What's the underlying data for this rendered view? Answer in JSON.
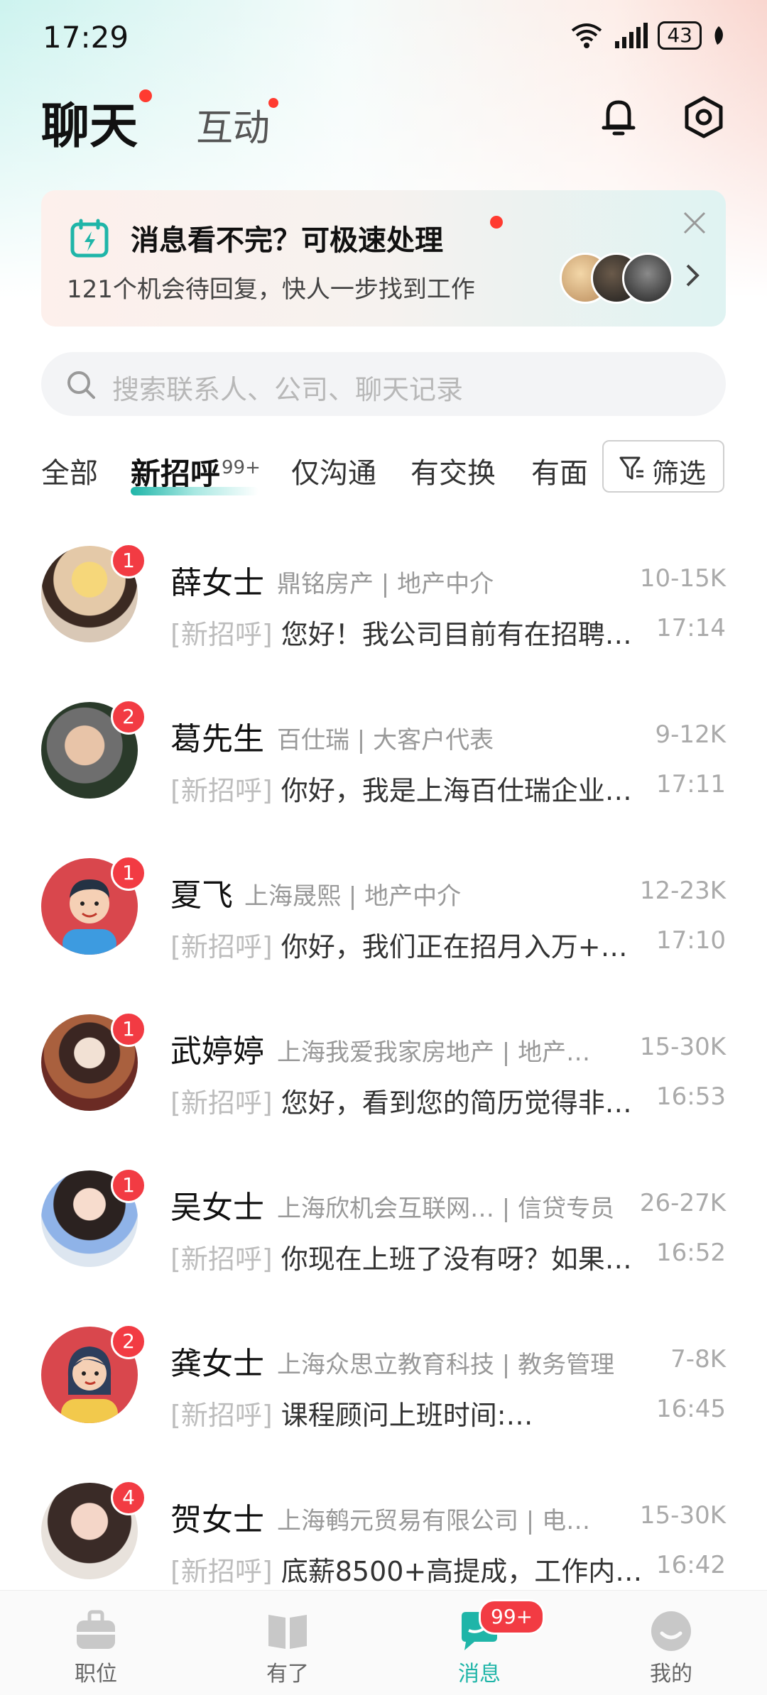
{
  "status_bar": {
    "time": "17:29",
    "battery": "43"
  },
  "header": {
    "tab_chat": "聊天",
    "tab_interact": "互动"
  },
  "banner": {
    "title": "消息看不完？可极速处理",
    "subtitle": "121个机会待回复，快人一步找到工作"
  },
  "search": {
    "placeholder": "搜索联系人、公司、聊天记录"
  },
  "filters": {
    "tabs": [
      "全部",
      "新招呼",
      "仅沟通",
      "有交换",
      "有面"
    ],
    "new_greeting_count": "99+",
    "filter_label": "筛选"
  },
  "conversations": [
    {
      "name": "薛女士",
      "company": "鼎铭房产 | 地产中介",
      "salary": "10-15K",
      "tag": "[新招呼]",
      "message": "您好！我公司目前有在招聘…",
      "time": "17:14",
      "unread": "1"
    },
    {
      "name": "葛先生",
      "company": "百仕瑞 | 大客户代表",
      "salary": "9-12K",
      "tag": "[新招呼]",
      "message": "你好，我是上海百仕瑞企业…",
      "time": "17:11",
      "unread": "2"
    },
    {
      "name": "夏飞",
      "company": "上海晟熙 | 地产中介",
      "salary": "12-23K",
      "tag": "[新招呼]",
      "message": "你好，我们正在招月入万+…",
      "time": "17:10",
      "unread": "1"
    },
    {
      "name": "武婷婷",
      "company": "上海我爱我家房地产 | 地产…",
      "salary": "15-30K",
      "tag": "[新招呼]",
      "message": "您好，看到您的简历觉得非…",
      "time": "16:53",
      "unread": "1"
    },
    {
      "name": "吴女士",
      "company": "上海欣机会互联网… | 信贷专员",
      "salary": "26-27K",
      "tag": "[新招呼]",
      "message": "你现在上班了没有呀？如果…",
      "time": "16:52",
      "unread": "1"
    },
    {
      "name": "龚女士",
      "company": "上海众思立教育科技 | 教务管理",
      "salary": "7-8K",
      "tag": "[新招呼]",
      "message": "课程顾问上班时间:…",
      "time": "16:45",
      "unread": "2"
    },
    {
      "name": "贺女士",
      "company": "上海鹌元贸易有限公司 | 电…",
      "salary": "15-30K",
      "tag": "[新招呼]",
      "message": "底薪8500+高提成，工作内…",
      "time": "16:42",
      "unread": "4"
    }
  ],
  "bottom_nav": {
    "items": [
      "职位",
      "有了",
      "消息",
      "我的"
    ],
    "message_badge": "99+"
  },
  "colors": {
    "accent": "#1fb5a8",
    "badge": "#f23b43"
  }
}
